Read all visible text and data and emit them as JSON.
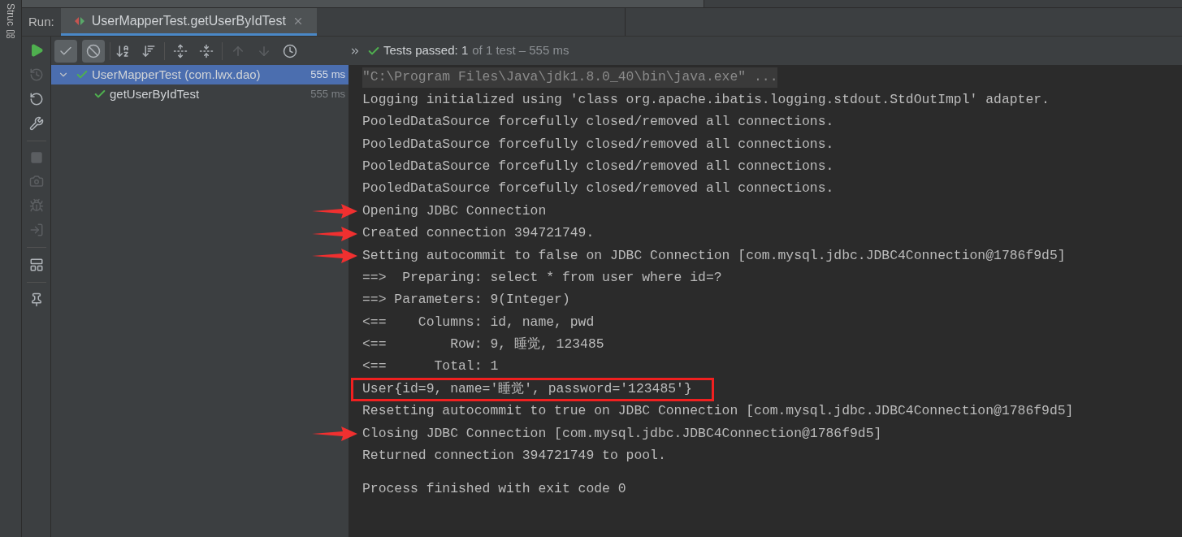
{
  "side_strip": {
    "label": "Struc"
  },
  "run_bar": {
    "label": "Run:",
    "tab": {
      "title": "UserMapperTest.getUserByIdTest",
      "selected": true
    }
  },
  "toolbar": {
    "show_passed": {
      "on": true
    },
    "show_ignored": {
      "on": true
    }
  },
  "status": {
    "passed": "Tests passed: 1",
    "detail": "of 1 test – 555 ms"
  },
  "tree": [
    {
      "label": "UserMapperTest (com.lwx.dao)",
      "time": "555 ms",
      "selected": true,
      "expanded": true,
      "children": [
        {
          "label": "getUserByIdTest",
          "time": "555 ms",
          "selected": false
        }
      ]
    }
  ],
  "console": [
    {
      "kind": "command",
      "text": "\"C:\\Program Files\\Java\\jdk1.8.0_40\\bin\\java.exe\" ..."
    },
    {
      "kind": "out",
      "text": "Logging initialized using 'class org.apache.ibatis.logging.stdout.StdOutImpl' adapter."
    },
    {
      "kind": "out",
      "text": "PooledDataSource forcefully closed/removed all connections."
    },
    {
      "kind": "out",
      "text": "PooledDataSource forcefully closed/removed all connections."
    },
    {
      "kind": "out",
      "text": "PooledDataSource forcefully closed/removed all connections."
    },
    {
      "kind": "out",
      "text": "PooledDataSource forcefully closed/removed all connections."
    },
    {
      "kind": "out",
      "text": "Opening JDBC Connection",
      "arrow": true
    },
    {
      "kind": "out",
      "text": "Created connection 394721749.",
      "arrow": true
    },
    {
      "kind": "out",
      "text": "Setting autocommit to false on JDBC Connection [com.mysql.jdbc.JDBC4Connection@1786f9d5]",
      "arrow": true
    },
    {
      "kind": "out",
      "text": "==>  Preparing: select * from user where id=?"
    },
    {
      "kind": "out",
      "text": "==> Parameters: 9(Integer)"
    },
    {
      "kind": "out",
      "text": "<==    Columns: id, name, pwd"
    },
    {
      "kind": "out",
      "text": "<==        Row: 9, 睡觉, 123485"
    },
    {
      "kind": "out",
      "text": "<==      Total: 1"
    },
    {
      "kind": "out",
      "text": "User{id=9, name='睡觉', password='123485'}",
      "boxed": true
    },
    {
      "kind": "out",
      "text": "Resetting autocommit to true on JDBC Connection [com.mysql.jdbc.JDBC4Connection@1786f9d5]"
    },
    {
      "kind": "out",
      "text": "Closing JDBC Connection [com.mysql.jdbc.JDBC4Connection@1786f9d5]",
      "arrow": true
    },
    {
      "kind": "out",
      "text": "Returned connection 394721749 to pool."
    },
    {
      "kind": "exit",
      "text": "Process finished with exit code 0"
    }
  ]
}
